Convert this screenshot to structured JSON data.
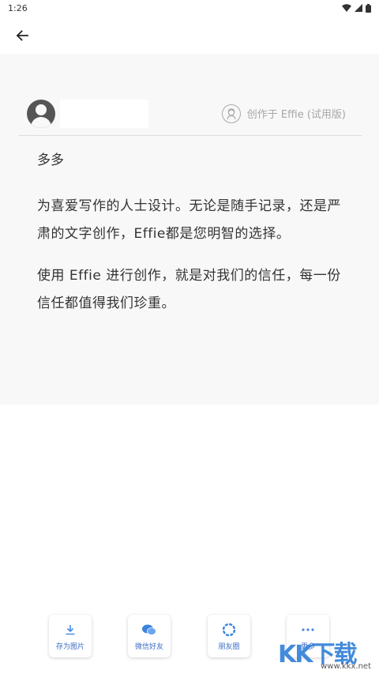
{
  "status_bar": {
    "time": "1:26",
    "icons": [
      "wifi-icon",
      "signal-icon",
      "battery-icon"
    ]
  },
  "app_bar": {
    "back_icon": "arrow-left-icon"
  },
  "card": {
    "created_by": "创作于 Effie (试用版)",
    "title": "多多",
    "paragraphs": [
      "为喜爱写作的人士设计。无论是随手记录，还是严肃的文字创作，Effie都是您明智的选择。",
      "使用 Effie 进行创作，就是对我们的信任，每一份信任都值得我们珍重。"
    ]
  },
  "share": [
    {
      "label": "存为图片",
      "icon": "download-icon"
    },
    {
      "label": "微信好友",
      "icon": "wechat-icon"
    },
    {
      "label": "朋友圈",
      "icon": "moments-icon"
    },
    {
      "label": "更多",
      "icon": "more-icon"
    }
  ],
  "watermark": {
    "big": "KK下载",
    "small": "www.kkx.net"
  },
  "colors": {
    "accent": "#3b6cc4",
    "card_bg": "#f8f8f9",
    "watermark": "#2f7fd8"
  }
}
